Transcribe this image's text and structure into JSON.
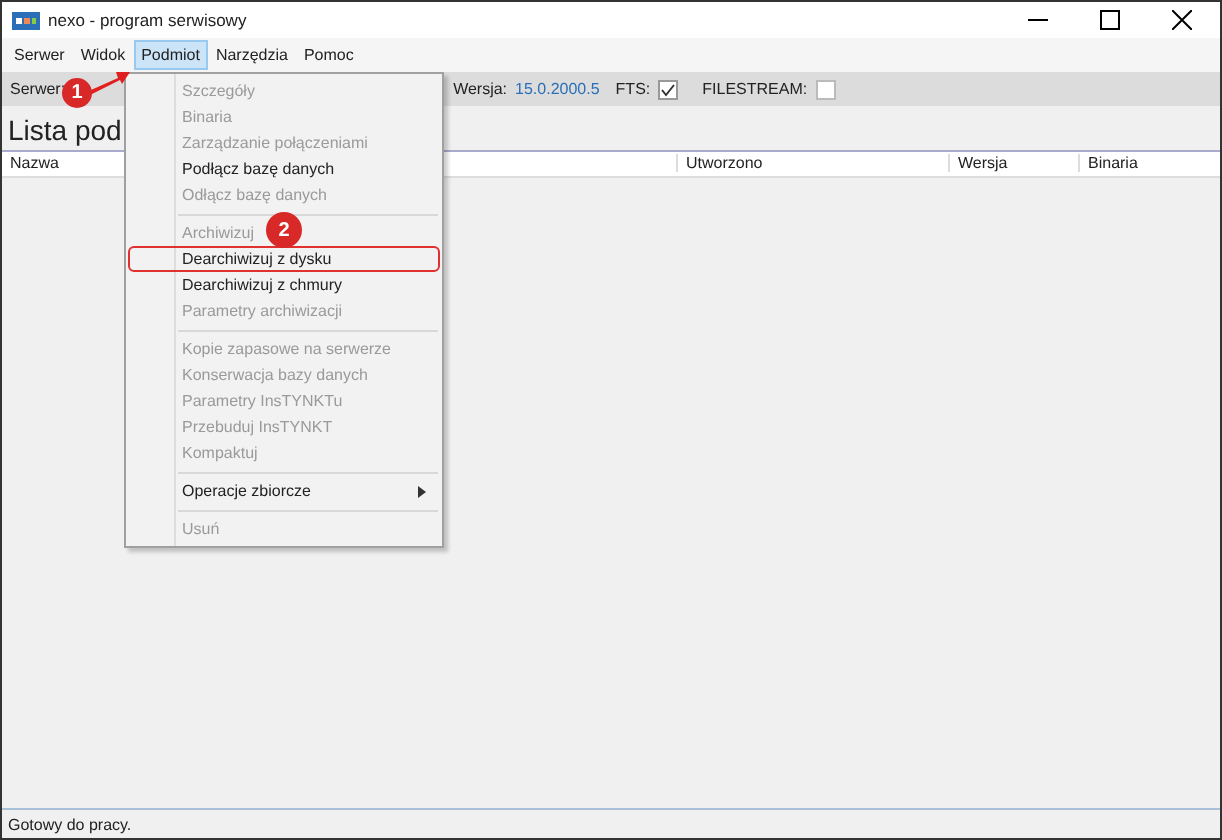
{
  "window": {
    "title": "nexo - program serwisowy"
  },
  "menu_bar": [
    {
      "label": "Serwer",
      "selected": false
    },
    {
      "label": "Widok",
      "selected": false
    },
    {
      "label": "Podmiot",
      "selected": true
    },
    {
      "label": "Narzędzia",
      "selected": false
    },
    {
      "label": "Pomoc",
      "selected": false
    }
  ],
  "toolbar": {
    "server_label": "Serwer:",
    "version_label": "Wersja:",
    "version_value": "15.0.2000.5",
    "fts": {
      "label": "FTS:",
      "checked": true
    },
    "filestream": {
      "label": "FILESTREAM:",
      "checked": false
    }
  },
  "heading": "Lista pod",
  "table": {
    "columns": [
      "Nazwa",
      "Utworzono",
      "Wersja",
      "Binaria"
    ]
  },
  "dropdown_menu": [
    {
      "kind": "item",
      "label": "Szczegóły",
      "disabled": true
    },
    {
      "kind": "item",
      "label": "Binaria",
      "disabled": true
    },
    {
      "kind": "item",
      "label": "Zarządzanie połączeniami",
      "disabled": true
    },
    {
      "kind": "item",
      "label": "Podłącz bazę danych",
      "disabled": false
    },
    {
      "kind": "item",
      "label": "Odłącz bazę danych",
      "disabled": true
    },
    {
      "kind": "separator"
    },
    {
      "kind": "item",
      "label": "Archiwizuj",
      "disabled": true
    },
    {
      "kind": "item",
      "label": "Dearchiwizuj z dysku",
      "disabled": false,
      "highlighted": true
    },
    {
      "kind": "item",
      "label": "Dearchiwizuj z chmury",
      "disabled": false
    },
    {
      "kind": "item",
      "label": "Parametry archiwizacji",
      "disabled": true
    },
    {
      "kind": "separator"
    },
    {
      "kind": "item",
      "label": "Kopie zapasowe na serwerze",
      "disabled": true
    },
    {
      "kind": "item",
      "label": "Konserwacja bazy danych",
      "disabled": true
    },
    {
      "kind": "item",
      "label": "Parametry InsTYNKTu",
      "disabled": true
    },
    {
      "kind": "item",
      "label": "Przebuduj InsTYNKT",
      "disabled": true
    },
    {
      "kind": "item",
      "label": "Kompaktuj",
      "disabled": true
    },
    {
      "kind": "separator"
    },
    {
      "kind": "submenu",
      "label": "Operacje zbiorcze",
      "disabled": false
    },
    {
      "kind": "separator"
    },
    {
      "kind": "item",
      "label": "Usuń",
      "disabled": true
    }
  ],
  "annotations": [
    {
      "kind": "arrow",
      "badge": "1"
    },
    {
      "kind": "badge",
      "badge": "2"
    }
  ],
  "status_bar": "Gotowy do pracy."
}
